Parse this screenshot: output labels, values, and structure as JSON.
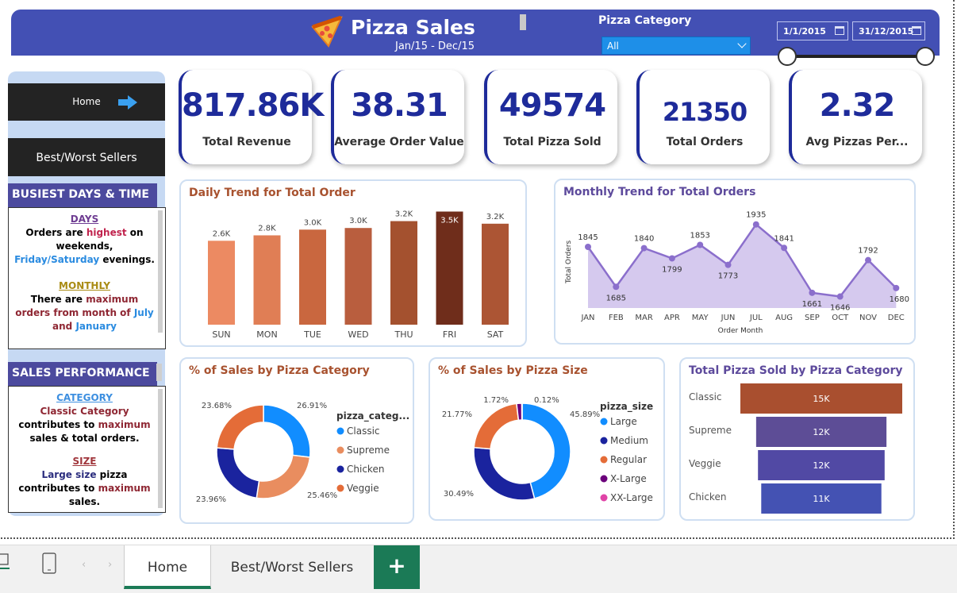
{
  "header": {
    "title": "Pizza Sales",
    "subtitle": "Jan/15 - Dec/15",
    "category_label": "Pizza Category",
    "category_value": "All",
    "date_start": "1/1/2015",
    "date_end": "31/12/2015",
    "brand_color": "#4350b4"
  },
  "nav": {
    "home_label": "Home",
    "best_worst_label": "Best/Worst Sellers",
    "busiest_heading": "BUSIEST DAYS & TIME",
    "days_title": "DAYS",
    "days_text_1": "Orders are ",
    "days_highlight": "highest",
    "days_text_2": " on weekends,",
    "days_blue": "Friday/Saturday",
    "days_text_3": " evenings.",
    "monthly_title": "MONTHLY",
    "monthly_text_1": "There are ",
    "monthly_highlight": "maximum orders from month of",
    "monthly_blue_1": "July",
    "monthly_and": " and ",
    "monthly_blue_2": "January",
    "sales_heading": "SALES PERFORMANCE",
    "category_title": "CATEGORY",
    "category_highlight": "Classic Category",
    "category_text": " contributes to",
    "category_highlight2": "maximum",
    "category_text2": " sales & total orders.",
    "size_title": "SIZE",
    "size_highlight": "Large size",
    "size_text": " pizza contributes to",
    "size_highlight2": "maximum",
    "size_text2": " sales."
  },
  "kpis": [
    {
      "value": "817.86K",
      "label": "Total Revenue"
    },
    {
      "value": "38.31",
      "label": "Average Order Value"
    },
    {
      "value": "49574",
      "label": "Total Pizza Sold"
    },
    {
      "value": "21350",
      "label": "Total Orders"
    },
    {
      "value": "2.32",
      "label": "Avg Pizzas Per..."
    }
  ],
  "panels": {
    "daily_title": "Daily Trend for Total Order",
    "monthly_title": "Monthly Trend for Total Orders",
    "monthly_ylabel": "Total Orders",
    "monthly_xlabel": "Order Month",
    "cat_title": "% of Sales by Pizza Category",
    "cat_legend_title": "pizza_categ...",
    "size_title": "% of Sales by Pizza Size",
    "size_legend_title": "pizza_size",
    "funnel_title": "Total Pizza Sold by Pizza Category"
  },
  "tabs": {
    "home": "Home",
    "best_worst": "Best/Worst Sellers",
    "add": "+"
  },
  "chart_data": [
    {
      "type": "bar",
      "title": "Daily Trend for Total Order",
      "categories": [
        "SUN",
        "MON",
        "TUE",
        "WED",
        "THU",
        "FRI",
        "SAT"
      ],
      "values": [
        2624,
        2794,
        2973,
        3024,
        3239,
        3538,
        3158
      ],
      "data_labels": [
        "2.6K",
        "2.8K",
        "3.0K",
        "3.0K",
        "3.2K",
        "3.5K",
        "3.2K"
      ],
      "colors": [
        "#ec8a62",
        "#e07e55",
        "#c9673f",
        "#b95e3e",
        "#a4512f",
        "#6f2d1b",
        "#ac5534"
      ]
    },
    {
      "type": "area",
      "title": "Monthly Trend for Total Orders",
      "categories": [
        "JAN",
        "FEB",
        "MAR",
        "APR",
        "MAY",
        "JUN",
        "JUL",
        "AUG",
        "SEP",
        "OCT",
        "NOV",
        "DEC"
      ],
      "values": [
        1845,
        1685,
        1840,
        1799,
        1853,
        1773,
        1935,
        1841,
        1661,
        1646,
        1792,
        1680
      ],
      "xlabel": "Order Month",
      "ylabel": "Total Orders",
      "ylim": [
        1600,
        1950
      ],
      "line_color": "#8b6fcc",
      "fill_color": "#d5c9ee"
    },
    {
      "type": "pie",
      "title": "% of Sales by Pizza Category",
      "legend_title": "pizza_categ...",
      "labels": [
        "Classic",
        "Supreme",
        "Chicken",
        "Veggie"
      ],
      "values": [
        26.91,
        25.46,
        23.96,
        23.68
      ],
      "value_labels": [
        "26.91%",
        "25.46%",
        "23.96%",
        "23.68%"
      ],
      "colors": [
        "#118dff",
        "#e98d5f",
        "#1a239e",
        "#e46c38"
      ]
    },
    {
      "type": "pie",
      "title": "% of Sales by Pizza Size",
      "legend_title": "pizza_size",
      "labels": [
        "Large",
        "Medium",
        "Regular",
        "X-Large",
        "XX-Large"
      ],
      "values": [
        45.89,
        30.49,
        21.77,
        1.72,
        0.12
      ],
      "value_labels": [
        "45.89%",
        "30.49%",
        "21.77%",
        "1.72%",
        "0.12%"
      ],
      "colors": [
        "#118dff",
        "#1a239e",
        "#e46c38",
        "#6b007b",
        "#e044a7"
      ]
    },
    {
      "type": "bar",
      "title": "Total Pizza Sold by Pizza Category",
      "categories": [
        "Classic",
        "Supreme",
        "Veggie",
        "Chicken"
      ],
      "values": [
        14888,
        11987,
        11649,
        11050
      ],
      "data_labels": [
        "15K",
        "12K",
        "12K",
        "11K"
      ],
      "colors": [
        "#a94f2f",
        "#5d4d96",
        "#5149a4",
        "#4452b3"
      ]
    }
  ]
}
